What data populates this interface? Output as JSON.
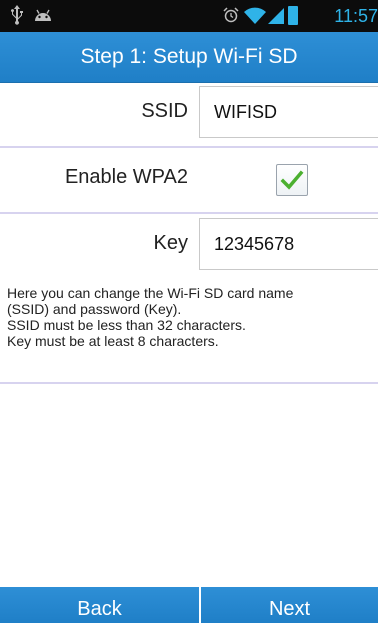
{
  "status_bar": {
    "time": "11:57",
    "icons": [
      "usb-icon",
      "android-icon",
      "alarm-icon",
      "wifi-icon",
      "signal-icon",
      "battery-icon"
    ]
  },
  "title": "Step 1: Setup Wi-Fi SD",
  "form": {
    "ssid_label": "SSID",
    "ssid_value": "WIFISD",
    "wpa_label": "Enable WPA2",
    "wpa_checked": true,
    "key_label": "Key",
    "key_value": "12345678"
  },
  "help_text": [
    "Here you can change the Wi-Fi SD card name",
    "(SSID) and password (Key).",
    "SSID must be less than 32 characters.",
    "Key must be at least 8 characters."
  ],
  "buttons": {
    "back": "Back",
    "next": "Next"
  },
  "colors": {
    "accent": "#2589d0",
    "divider": "#d7d3ef",
    "checkmark": "#4cb030",
    "status_icon": "#2fb3e8"
  }
}
